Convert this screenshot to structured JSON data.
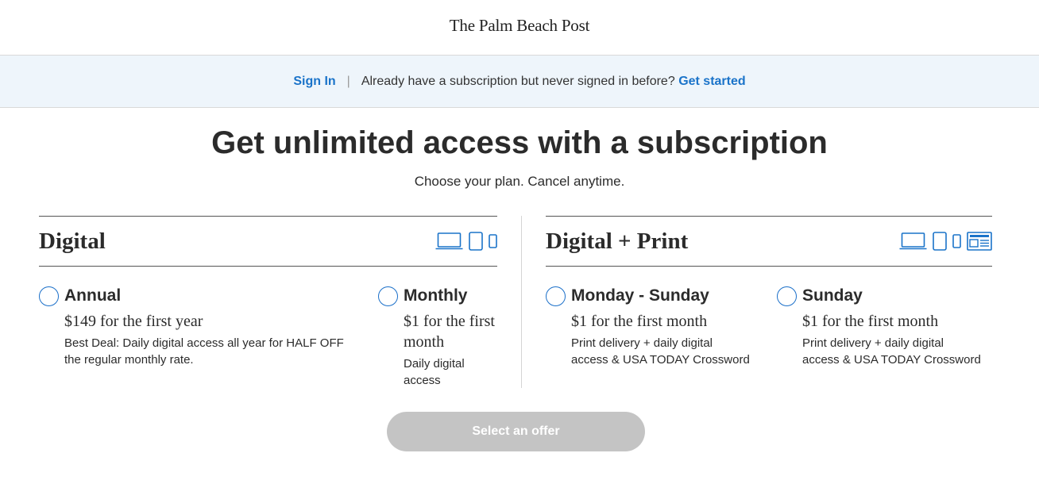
{
  "header": {
    "logo_text": "The Palm Beach Post"
  },
  "signin_bar": {
    "sign_in_label": "Sign In",
    "separator": "|",
    "prompt_text": "Already have a subscription but never signed in before?",
    "get_started_label": "Get started"
  },
  "main": {
    "headline": "Get unlimited access with a subscription",
    "subheadline": "Choose your plan. Cancel anytime."
  },
  "plans": {
    "digital": {
      "title": "Digital",
      "device_icons": [
        "laptop-icon",
        "tablet-icon",
        "phone-icon"
      ],
      "options": [
        {
          "name": "Annual",
          "price": "$149 for the first year",
          "description": "Best Deal: Daily digital access all year for HALF OFF the regular monthly rate."
        },
        {
          "name": "Monthly",
          "price": "$1 for the first month",
          "description": "Daily digital access"
        }
      ]
    },
    "digital_print": {
      "title": "Digital + Print",
      "device_icons": [
        "laptop-icon",
        "tablet-icon",
        "phone-icon",
        "newspaper-icon"
      ],
      "options": [
        {
          "name": "Monday - Sunday",
          "price": "$1 for the first month",
          "description": "Print delivery + daily digital access & USA TODAY Crossword"
        },
        {
          "name": "Sunday",
          "price": "$1 for the first month",
          "description": "Print delivery + daily digital access & USA TODAY Crossword"
        }
      ]
    }
  },
  "cta": {
    "label": "Select an offer",
    "state": "disabled"
  },
  "colors": {
    "accent_blue": "#1a73c9",
    "signin_bar_bg": "#eef5fb",
    "text_dark": "#2b2b2b",
    "cta_disabled_bg": "#c4c4c4"
  }
}
